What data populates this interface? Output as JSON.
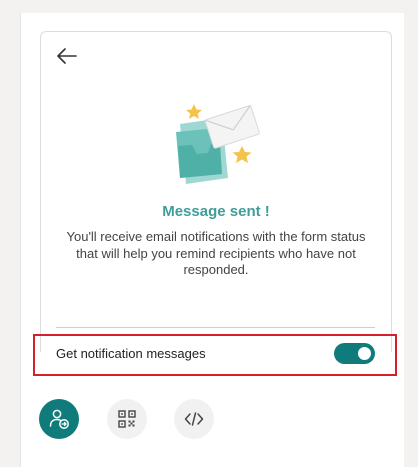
{
  "confirmation": {
    "title": "Message sent !",
    "description": "You'll receive email notifications with the form status that will help you remind recipients who have not responded."
  },
  "notification": {
    "label": "Get notification messages",
    "enabled": true
  },
  "icons": {
    "back": "arrow-left-icon",
    "illustration": "envelope-inbox-illustration",
    "share_person": "person-share-icon",
    "qr": "qr-code-icon",
    "embed": "code-embed-icon"
  },
  "colors": {
    "accent": "#0f7b7b",
    "title": "#3f9d9a",
    "highlight_border": "#d4202a"
  }
}
